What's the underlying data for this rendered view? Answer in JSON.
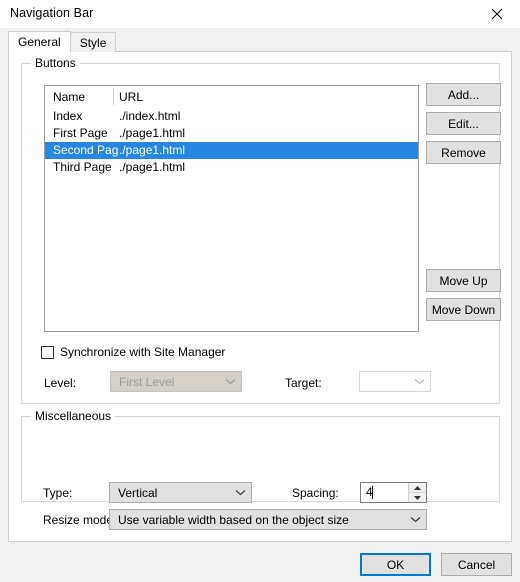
{
  "window": {
    "title": "Navigation Bar",
    "close_icon": "close-icon"
  },
  "tabs": [
    {
      "label": "General",
      "active": true
    },
    {
      "label": "Style",
      "active": false
    }
  ],
  "groups": {
    "buttons": {
      "legend": "Buttons"
    },
    "miscellaneous": {
      "legend": "Miscellaneous"
    }
  },
  "list": {
    "columns": [
      "Name",
      "URL"
    ],
    "rows": [
      {
        "name": "Index",
        "url": "./index.html",
        "selected": false
      },
      {
        "name": "First Page",
        "url": "./page1.html",
        "selected": false
      },
      {
        "name": "Second Page",
        "url": "./page1.html",
        "selected": true
      },
      {
        "name": "Third Page",
        "url": "./page1.html",
        "selected": false
      }
    ],
    "selection_color": "#2686e2"
  },
  "side_buttons": {
    "add": "Add...",
    "edit": "Edit...",
    "remove": "Remove",
    "move_up": "Move Up",
    "move_down": "Move Down"
  },
  "sync": {
    "label": "Synchronize with Site Manager",
    "checked": false
  },
  "level": {
    "label": "Level:",
    "value": "First Level",
    "disabled": true
  },
  "target": {
    "label": "Target:",
    "value": "",
    "disabled": true
  },
  "type": {
    "label": "Type:",
    "value": "Vertical"
  },
  "spacing": {
    "label": "Spacing:",
    "value": "4"
  },
  "resize_mode": {
    "label": "Resize mode:",
    "value": "Use variable width based on the object size"
  },
  "footer": {
    "ok": "OK",
    "cancel": "Cancel",
    "focus_color": "#0078d7"
  }
}
